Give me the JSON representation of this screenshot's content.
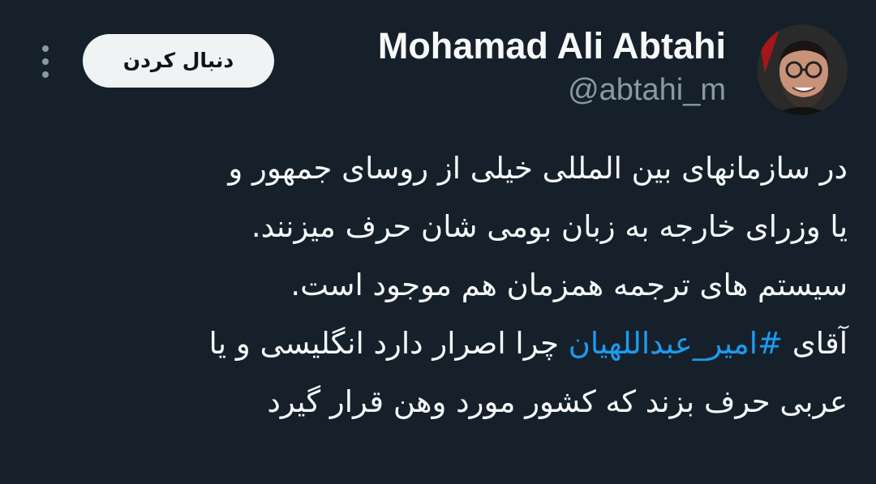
{
  "author": {
    "display_name": "Mohamad Ali Abtahi",
    "handle": "@abtahi_m",
    "avatar_icon": "profile-photo"
  },
  "actions": {
    "follow_label": "دنبال کردن",
    "more_icon": "more-vertical-icon"
  },
  "tweet": {
    "lines": [
      "در سازمانهای بین المللی خیلی از روسای جمهور و",
      "یا وزرای خارجه به زبان بومی شان حرف میزنند.",
      "سیستم های ترجمه همزمان هم موجود است."
    ],
    "line4_prefix": "آقای",
    "hashtag": "#امیر_عبداللهیان",
    "line4_suffix": "چرا اصرار دارد انگلیسی و یا",
    "line5": "عربی حرف بزند که کشور مورد وهن قرار گیرد"
  },
  "colors": {
    "background": "#15202b",
    "text": "#f7f9f9",
    "secondary_text": "#8b98a5",
    "link": "#1d9bf0",
    "button_bg": "#eff3f4"
  }
}
